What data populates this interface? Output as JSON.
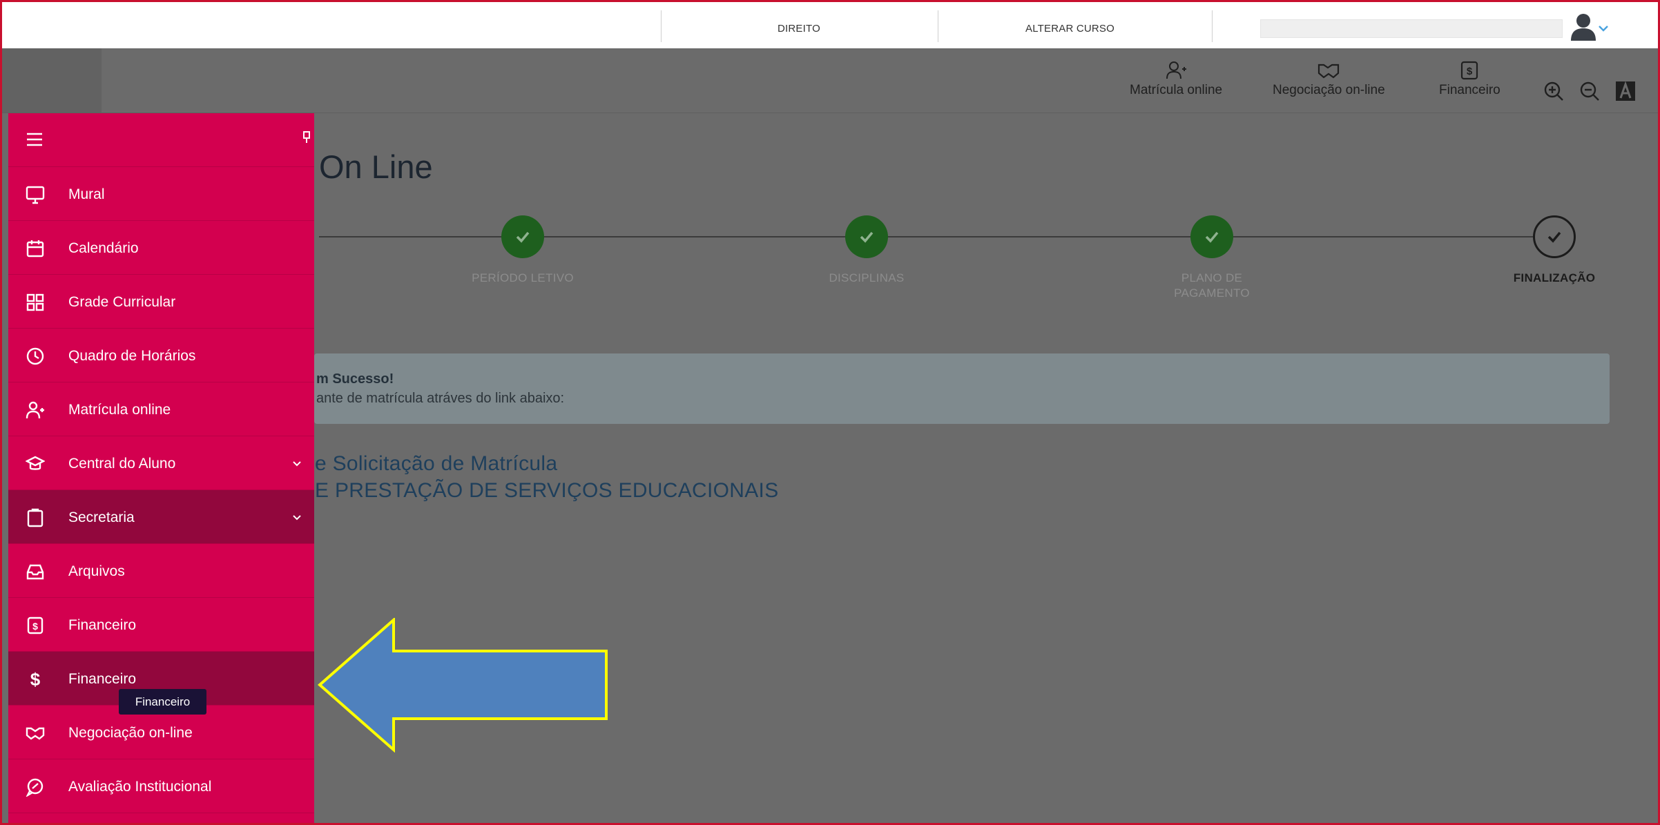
{
  "topbar": {
    "course_label": "DIREITO",
    "change_course_label": "ALTERAR CURSO"
  },
  "header": {
    "items": [
      {
        "label": "Matrícula online",
        "icon": "user-plus-icon"
      },
      {
        "label": "Negociação on-line",
        "icon": "handshake-icon"
      },
      {
        "label": "Financeiro",
        "icon": "dollar-document-icon"
      }
    ],
    "zoom_in_icon": "zoom-in-icon",
    "zoom_out_icon": "zoom-out-icon",
    "font_icon": "font-size-icon"
  },
  "main": {
    "title": "On Line",
    "steps": [
      {
        "label": "PERÍODO LETIVO",
        "status": "done"
      },
      {
        "label": "DISCIPLINAS",
        "status": "done"
      },
      {
        "label_line1": "PLANO DE",
        "label_line2": "PAGAMENTO",
        "status": "done"
      },
      {
        "label": "FINALIZAÇÃO",
        "status": "current"
      }
    ],
    "alert": {
      "title": "m Sucesso!",
      "text": "ante de matrícula atráves do link abaixo:"
    },
    "links": [
      "e Solicitação de Matrícula",
      "E PRESTAÇÃO DE SERVIÇOS EDUCACIONAIS"
    ]
  },
  "sidebar": {
    "items": [
      {
        "label": "Mural",
        "icon": "monitor-icon"
      },
      {
        "label": "Calendário",
        "icon": "calendar-icon"
      },
      {
        "label": "Grade Curricular",
        "icon": "grid-icon"
      },
      {
        "label": "Quadro de Horários",
        "icon": "clock-icon"
      },
      {
        "label": "Matrícula online",
        "icon": "user-plus-icon"
      },
      {
        "label": "Central do Aluno",
        "icon": "graduation-cap-icon",
        "expandable": true
      },
      {
        "label": "Secretaria",
        "icon": "clipboard-icon",
        "expandable": true,
        "active": true
      },
      {
        "label": "Arquivos",
        "icon": "inbox-icon"
      },
      {
        "label": "Financeiro",
        "icon": "dollar-document-icon"
      },
      {
        "label": "Financeiro",
        "icon": "dollar-icon",
        "active": true
      },
      {
        "label": "Negociação on-line",
        "icon": "handshake-icon"
      },
      {
        "label": "Avaliação Institucional",
        "icon": "chat-icon"
      }
    ],
    "tooltip": "Financeiro"
  },
  "colors": {
    "sidebar": "#d3004f",
    "sidebar_active": "#92073d",
    "overlay": "#6b6b6b",
    "step_done": "#1e5f1e",
    "arrow_fill": "#4f81bd",
    "arrow_stroke": "#ffff00"
  }
}
